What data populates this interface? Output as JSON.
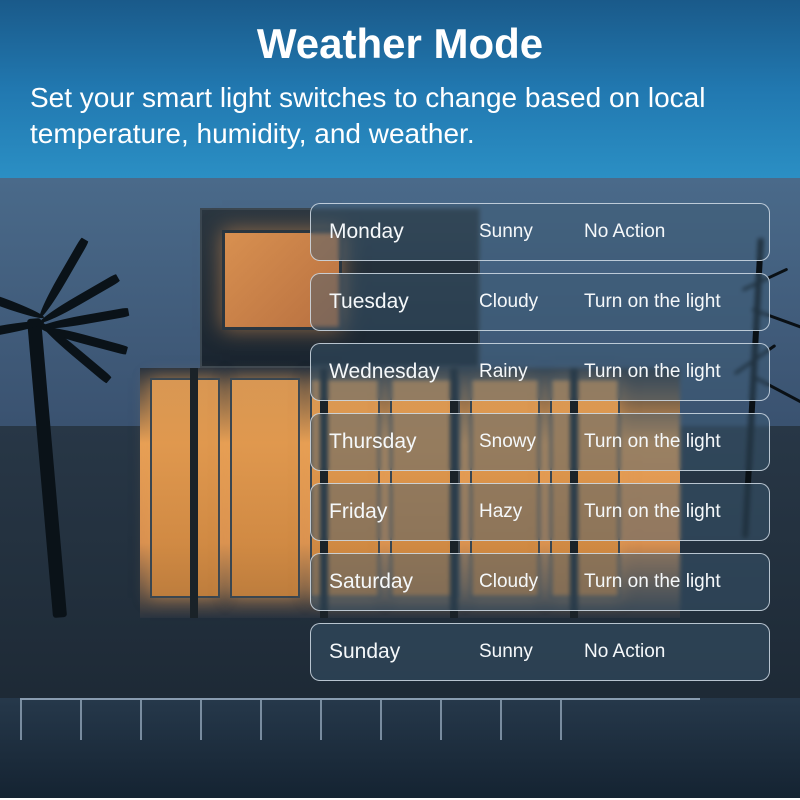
{
  "header": {
    "title": "Weather Mode",
    "subtitle": "Set your smart light switches to change based on local temperature, humidity, and weather."
  },
  "schedule": [
    {
      "day": "Monday",
      "weather": "Sunny",
      "action": "No Action"
    },
    {
      "day": "Tuesday",
      "weather": "Cloudy",
      "action": "Turn on the light"
    },
    {
      "day": "Wednesday",
      "weather": "Rainy",
      "action": "Turn on the light"
    },
    {
      "day": "Thursday",
      "weather": "Snowy",
      "action": "Turn on the light"
    },
    {
      "day": "Friday",
      "weather": "Hazy",
      "action": "Turn on the light"
    },
    {
      "day": "Saturday",
      "weather": "Cloudy",
      "action": "Turn on the light"
    },
    {
      "day": "Sunday",
      "weather": "Sunny",
      "action": "No Action"
    }
  ]
}
